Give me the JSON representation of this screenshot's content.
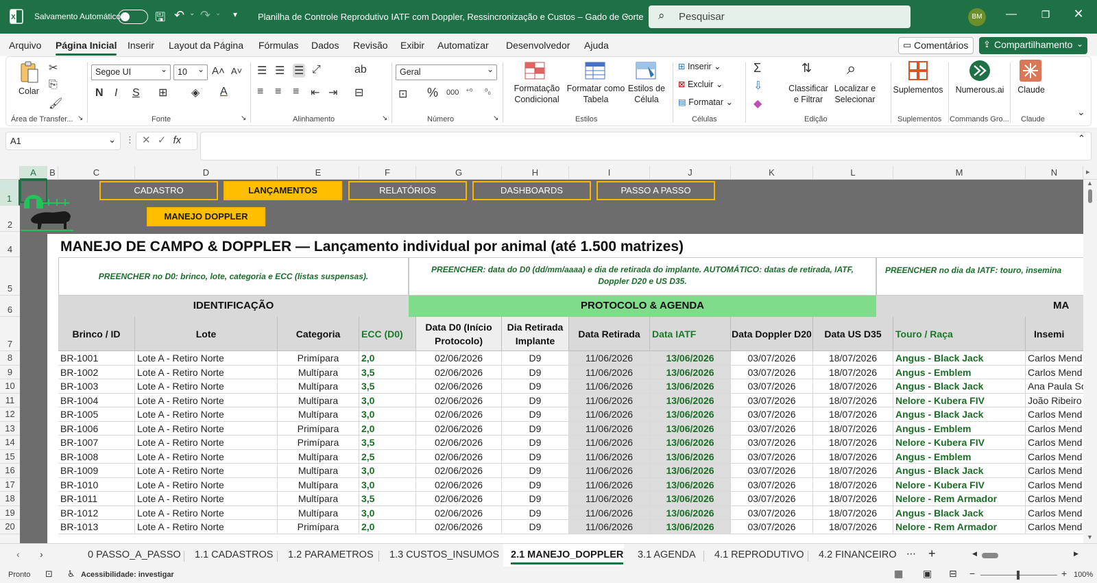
{
  "titlebar": {
    "autosave_label": "Salvamento Automático",
    "doc_title": "Planilha de Controle Reprodutivo IATF com Doppler, Ressincronização e Custos – Gado de Corte",
    "search_placeholder": "Pesquisar",
    "avatar_initials": "BM"
  },
  "menu": {
    "tabs": [
      "Arquivo",
      "Página Inicial",
      "Inserir",
      "Layout da Página",
      "Fórmulas",
      "Dados",
      "Revisão",
      "Exibir",
      "Automatizar",
      "Desenvolvedor",
      "Ajuda"
    ],
    "comments_label": "Comentários",
    "share_label": "Compartilhamento"
  },
  "ribbon": {
    "groups": [
      "Área de Transfer...",
      "Fonte",
      "Alinhamento",
      "Número",
      "Estilos",
      "Células",
      "Edição",
      "Suplementos",
      "Commands Gro...",
      "Claude"
    ],
    "paste_label": "Colar",
    "font_name": "Segoe UI",
    "font_size": "10",
    "number_format": "Geral",
    "cond_format": "Formatação\nCondicional",
    "format_table": "Formatar como\nTabela",
    "cell_styles": "Estilos de\nCélula",
    "insert": "Inserir",
    "delete": "Excluir",
    "format": "Formatar",
    "sort_filter": "Classificar\ne Filtrar",
    "find_select": "Localizar e\nSelecionar",
    "addins": "Suplementos",
    "numerous": "Numerous.ai",
    "claude": "Claude"
  },
  "formula_bar": {
    "name_box": "A1",
    "fx": "fx",
    "formula": ""
  },
  "columns": [
    "A",
    "B",
    "C",
    "D",
    "E",
    "F",
    "G",
    "H",
    "I",
    "J",
    "K",
    "L",
    "M",
    "N"
  ],
  "row_numbers": [
    "1",
    "2",
    "4",
    "5",
    "6",
    "7",
    "8",
    "9",
    "10",
    "11",
    "12",
    "13",
    "14",
    "15",
    "16",
    "17",
    "18",
    "19",
    "20"
  ],
  "nav": {
    "buttons": [
      "CADASTRO",
      "LANÇAMENTOS",
      "RELATÓRIOS",
      "DASHBOARDS",
      "PASSO A PASSO"
    ],
    "active": "LANÇAMENTOS",
    "sub_button": "MANEJO DOPPLER"
  },
  "page": {
    "title": "MANEJO DE CAMPO & DOPPLER — Lançamento individual por animal (até 1.500 matrizes)",
    "instr1": "PREENCHER no D0: brinco, lote, categoria e ECC (listas suspensas).",
    "instr2": "PREENCHER: data do D0 (dd/mm/aaaa) e dia de retirada do implante. AUTOMÁTICO: datas de retirada, IATF, Doppler D20 e US D35.",
    "instr3": "PREENCHER no dia da IATF: touro, insemina",
    "sections": [
      "IDENTIFICAÇÃO",
      "PROTOCOLO & AGENDA",
      "MA"
    ]
  },
  "table": {
    "headers": [
      "Brinco / ID",
      "Lote",
      "Categoria",
      "ECC (D0)",
      "Data D0 (Início Protocolo)",
      "Dia Retirada Implante",
      "Data Retirada",
      "Data IATF",
      "Data Doppler D20",
      "Data US D35",
      "Touro / Raça",
      "Insemi"
    ],
    "rows": [
      [
        "BR-1001",
        "Lote A - Retiro Norte",
        "Primípara",
        "2,0",
        "02/06/2026",
        "D9",
        "11/06/2026",
        "13/06/2026",
        "03/07/2026",
        "18/07/2026",
        "Angus - Black Jack",
        "Carlos Mend"
      ],
      [
        "BR-1002",
        "Lote A - Retiro Norte",
        "Multípara",
        "3,5",
        "02/06/2026",
        "D9",
        "11/06/2026",
        "13/06/2026",
        "03/07/2026",
        "18/07/2026",
        "Angus - Emblem",
        "Carlos Mend"
      ],
      [
        "BR-1003",
        "Lote A - Retiro Norte",
        "Multípara",
        "3,5",
        "02/06/2026",
        "D9",
        "11/06/2026",
        "13/06/2026",
        "03/07/2026",
        "18/07/2026",
        "Angus - Black Jack",
        "Ana Paula So"
      ],
      [
        "BR-1004",
        "Lote A - Retiro Norte",
        "Multípara",
        "3,0",
        "02/06/2026",
        "D9",
        "11/06/2026",
        "13/06/2026",
        "03/07/2026",
        "18/07/2026",
        "Nelore - Kubera FIV",
        "João Ribeiro"
      ],
      [
        "BR-1005",
        "Lote A - Retiro Norte",
        "Multípara",
        "3,0",
        "02/06/2026",
        "D9",
        "11/06/2026",
        "13/06/2026",
        "03/07/2026",
        "18/07/2026",
        "Angus - Black Jack",
        "Carlos Mend"
      ],
      [
        "BR-1006",
        "Lote A - Retiro Norte",
        "Primípara",
        "2,0",
        "02/06/2026",
        "D9",
        "11/06/2026",
        "13/06/2026",
        "03/07/2026",
        "18/07/2026",
        "Angus - Emblem",
        "Carlos Mend"
      ],
      [
        "BR-1007",
        "Lote A - Retiro Norte",
        "Primípara",
        "3,5",
        "02/06/2026",
        "D9",
        "11/06/2026",
        "13/06/2026",
        "03/07/2026",
        "18/07/2026",
        "Nelore - Kubera FIV",
        "Carlos Mend"
      ],
      [
        "BR-1008",
        "Lote A - Retiro Norte",
        "Multípara",
        "2,5",
        "02/06/2026",
        "D9",
        "11/06/2026",
        "13/06/2026",
        "03/07/2026",
        "18/07/2026",
        "Angus - Emblem",
        "Carlos Mend"
      ],
      [
        "BR-1009",
        "Lote A - Retiro Norte",
        "Multípara",
        "3,0",
        "02/06/2026",
        "D9",
        "11/06/2026",
        "13/06/2026",
        "03/07/2026",
        "18/07/2026",
        "Angus - Black Jack",
        "Carlos Mend"
      ],
      [
        "BR-1010",
        "Lote A - Retiro Norte",
        "Multípara",
        "3,0",
        "02/06/2026",
        "D9",
        "11/06/2026",
        "13/06/2026",
        "03/07/2026",
        "18/07/2026",
        "Nelore - Kubera FIV",
        "Carlos Mend"
      ],
      [
        "BR-1011",
        "Lote A - Retiro Norte",
        "Multípara",
        "3,5",
        "02/06/2026",
        "D9",
        "11/06/2026",
        "13/06/2026",
        "03/07/2026",
        "18/07/2026",
        "Nelore - Rem Armador",
        "Carlos Mend"
      ],
      [
        "BR-1012",
        "Lote A - Retiro Norte",
        "Multípara",
        "3,0",
        "02/06/2026",
        "D9",
        "11/06/2026",
        "13/06/2026",
        "03/07/2026",
        "18/07/2026",
        "Angus - Black Jack",
        "Carlos Mend"
      ],
      [
        "BR-1013",
        "Lote A - Retiro Norte",
        "Primípara",
        "2,0",
        "02/06/2026",
        "D9",
        "11/06/2026",
        "13/06/2026",
        "03/07/2026",
        "18/07/2026",
        "Nelore - Rem Armador",
        "Carlos Mend"
      ]
    ]
  },
  "sheet_tabs": [
    "0 PASSO_A_PASSO",
    "1.1 CADASTROS",
    "1.2 PARAMETROS",
    "1.3 CUSTOS_INSUMOS",
    "2.1 MANEJO_DOPPLER",
    "3.1 AGENDA",
    "4.1 REPRODUTIVO",
    "4.2 FINANCEIRO"
  ],
  "active_sheet": "2.1 MANEJO_DOPPLER",
  "status": {
    "ready": "Pronto",
    "accessibility": "Acessibilidade: investigar",
    "zoom": "100%"
  },
  "colors": {
    "excel_green": "#1e7145",
    "nav_yellow": "#ffbf00",
    "nav_band": "#6d6d6d",
    "protocol_green": "#7fdc8a",
    "text_green": "#1a6e26"
  }
}
